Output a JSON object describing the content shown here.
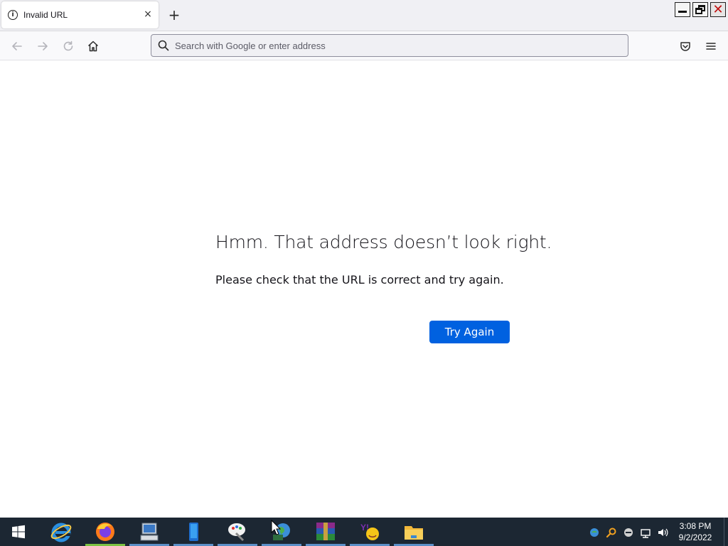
{
  "browser": {
    "tab": {
      "title": "Invalid URL",
      "close_glyph": "×",
      "icon": "info-icon"
    },
    "new_tab_glyph": "+",
    "url_placeholder": "Search with Google or enter address",
    "url_value": ""
  },
  "error_page": {
    "title": "Hmm. That address doesn’t look right.",
    "description": "Please check that the URL is correct and try again.",
    "button_label": "Try Again",
    "button_color": "#0061e0"
  },
  "taskbar": {
    "apps": [
      "internet-explorer-icon",
      "firefox-icon",
      "my-computer-icon",
      "blue-app-icon",
      "paint-icon",
      "network-globe-icon",
      "winrar-icon",
      "yahoo-messenger-icon",
      "file-explorer-icon"
    ],
    "clock": {
      "time": "3:08 PM",
      "date": "9/2/2022"
    },
    "background_color": "#1c2733"
  }
}
